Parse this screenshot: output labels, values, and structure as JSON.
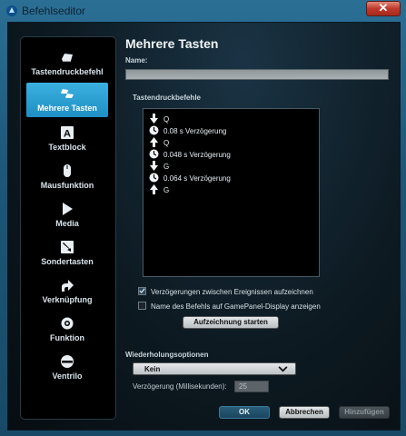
{
  "window": {
    "title": "Befehlseditor",
    "close_glyph": "✕"
  },
  "sidebar": {
    "items": [
      {
        "label": "Tastendruckbefehl",
        "icon": "key-icon",
        "active": false
      },
      {
        "label": "Mehrere Tasten",
        "icon": "multi-key-icon",
        "active": true
      },
      {
        "label": "Textblock",
        "icon": "text-block-icon",
        "active": false
      },
      {
        "label": "Mausfunktion",
        "icon": "mouse-icon",
        "active": false
      },
      {
        "label": "Media",
        "icon": "play-icon",
        "active": false
      },
      {
        "label": "Sondertasten",
        "icon": "special-key-icon",
        "active": false
      },
      {
        "label": "Verknüpfung",
        "icon": "shortcut-arrow-icon",
        "active": false
      },
      {
        "label": "Funktion",
        "icon": "function-gear-icon",
        "active": false
      },
      {
        "label": "Ventrilo",
        "icon": "headset-icon",
        "active": false
      }
    ]
  },
  "main": {
    "heading": "Mehrere Tasten",
    "name_label": "Name:",
    "name_value": "",
    "commands_label": "Tastendruckbefehle",
    "commands": [
      {
        "kind": "down",
        "text": "Q"
      },
      {
        "kind": "delay",
        "text": "0.08 s Verzögerung"
      },
      {
        "kind": "up",
        "text": "Q"
      },
      {
        "kind": "delay",
        "text": "0.048 s Verzögerung"
      },
      {
        "kind": "down",
        "text": "G"
      },
      {
        "kind": "delay",
        "text": "0.064 s Verzögerung"
      },
      {
        "kind": "up",
        "text": "G"
      }
    ],
    "record_delays": {
      "label": "Verzögerungen zwischen Ereignissen aufzeichnen",
      "checked": true
    },
    "show_name": {
      "label": "Name des Befehls auf GamePanel-Display anzeigen",
      "checked": false
    },
    "record_button": "Aufzeichnung starten"
  },
  "repeat": {
    "section_label": "Wiederholungsoptionen",
    "selected": "Kein",
    "delay_label": "Verzögerung (Millisekunden):",
    "delay_value": "25"
  },
  "footer": {
    "ok": "OK",
    "cancel": "Abbrechen",
    "add": "Hinzufügen"
  },
  "colors": {
    "accent": "#1f8fc4",
    "window": "#1d5678",
    "panel": "#000000"
  }
}
